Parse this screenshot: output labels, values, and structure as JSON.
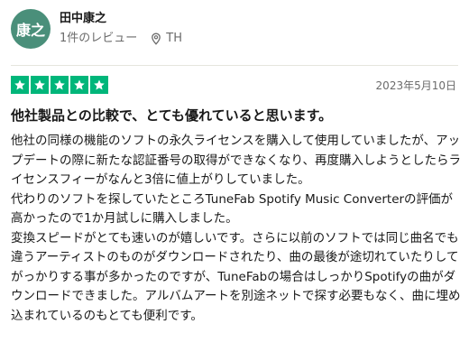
{
  "reviewer": {
    "avatar_text": "康之",
    "name": "田中康之",
    "review_count": "1件のレビュー",
    "location": "TH",
    "avatar_color": "#4a8f7a"
  },
  "review": {
    "stars": 5,
    "star_color": "#00b67a",
    "date": "2023年5月10日",
    "title": "他社製品との比較で、とても優れていると思います。",
    "paragraphs": [
      "他社の同様の機能のソフトの永久ライセンスを購入して使用していましたが、アップデートの際に新たな認証番号の取得ができなくなり、再度購入しようとしたらライセンスフィーがなんと3倍に値上がりしていました。",
      "代わりのソフトを探していたところTuneFab Spotify Music Converterの評価が高かったので1か月試しに購入しました。",
      "変換スピードがとても速いのが嬉しいです。さらに以前のソフトでは同じ曲名でも違うアーティストのものがダウンロードされたり、曲の最後が途切れていたりしてがっかりする事が多かったのですが、TuneFabの場合はしっかりSpotifyの曲がダウンロードできました。アルバムアートを別途ネットで探す必要もなく、曲に埋め込まれているのもとても便利です。"
    ]
  },
  "icons": {
    "location": "location-pin-icon",
    "star": "star-icon"
  }
}
